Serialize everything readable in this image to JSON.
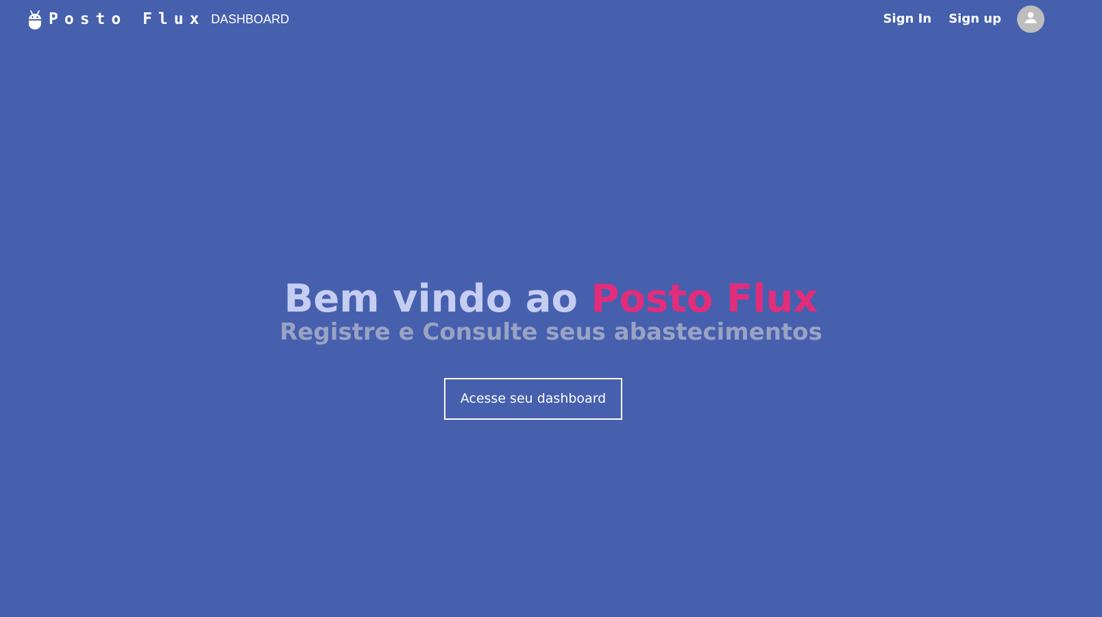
{
  "navbar": {
    "brand_icon": "android-icon",
    "brand_name": "Posto Flux",
    "dashboard_link": "DASHBOARD",
    "sign_in": "Sign In",
    "sign_up": "Sign up",
    "avatar_icon": "user-icon"
  },
  "hero": {
    "title_prefix": "Bem vindo ao ",
    "title_highlight": "Posto Flux",
    "subtitle": "Registre e Consulte seus abastecimentos",
    "cta_label": "Acesse seu dashboard"
  },
  "colors": {
    "background": "#4660ae",
    "title": "#c5cdf2",
    "accent": "#e22d7b",
    "subtitle": "#9aa3c4",
    "avatar": "#bdbdbd"
  }
}
